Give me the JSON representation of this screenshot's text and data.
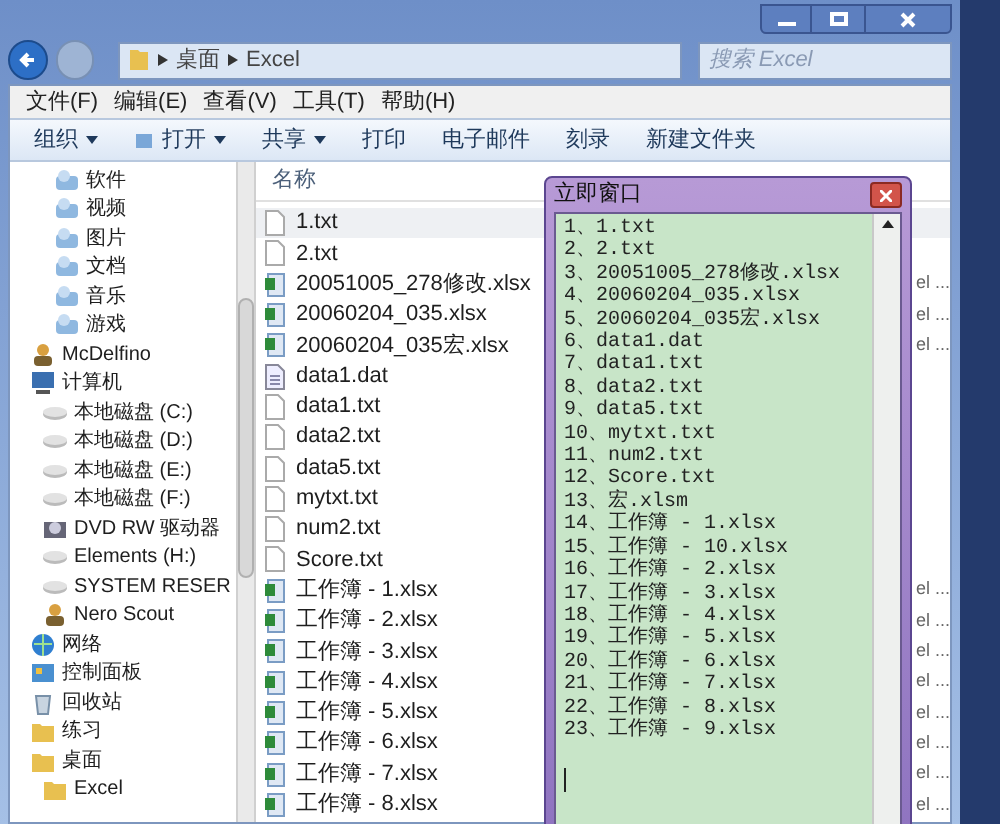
{
  "address_bar": {
    "path": [
      "桌面",
      "Excel"
    ],
    "search_placeholder": "搜索 Excel"
  },
  "menu_bar": [
    "文件(F)",
    "编辑(E)",
    "查看(V)",
    "工具(T)",
    "帮助(H)"
  ],
  "toolbar": [
    {
      "label": "组织",
      "dropdown": true
    },
    {
      "label": "打开",
      "dropdown": true,
      "icon": true
    },
    {
      "label": "共享",
      "dropdown": true
    },
    {
      "label": "打印",
      "dropdown": false
    },
    {
      "label": "电子邮件",
      "dropdown": false
    },
    {
      "label": "刻录",
      "dropdown": false
    },
    {
      "label": "新建文件夹",
      "dropdown": false
    }
  ],
  "sidebar": {
    "items": [
      {
        "children": [
          {
            "label": "软件",
            "kind": "library"
          },
          {
            "label": "视频",
            "kind": "library"
          },
          {
            "label": "图片",
            "kind": "library"
          },
          {
            "label": "文档",
            "kind": "library"
          },
          {
            "label": "音乐",
            "kind": "library"
          },
          {
            "label": "游戏",
            "kind": "library"
          }
        ]
      },
      {
        "label": "McDelfino",
        "kind": "user"
      },
      {
        "label": "计算机",
        "kind": "computer",
        "children": [
          {
            "label": "本地磁盘 (C:)",
            "kind": "drive"
          },
          {
            "label": "本地磁盘 (D:)",
            "kind": "drive"
          },
          {
            "label": "本地磁盘 (E:)",
            "kind": "drive"
          },
          {
            "label": "本地磁盘 (F:)",
            "kind": "drive"
          },
          {
            "label": "DVD RW 驱动器",
            "kind": "dvd"
          },
          {
            "label": "Elements (H:)",
            "kind": "drive"
          },
          {
            "label": "SYSTEM RESER",
            "kind": "drive"
          },
          {
            "label": "Nero Scout",
            "kind": "user"
          }
        ]
      },
      {
        "label": "网络",
        "kind": "network"
      },
      {
        "label": "控制面板",
        "kind": "control"
      },
      {
        "label": "回收站",
        "kind": "recycle"
      },
      {
        "label": "练习",
        "kind": "folder"
      },
      {
        "label": "桌面",
        "kind": "folder",
        "children": [
          {
            "label": "Excel",
            "kind": "folder"
          }
        ]
      }
    ]
  },
  "file_list": {
    "columns": [
      "名称"
    ],
    "rows": [
      {
        "name": "1.txt",
        "kind": "txt",
        "selected": true
      },
      {
        "name": "2.txt",
        "kind": "txt",
        "selected": false
      },
      {
        "name": "20051005_278修改.xlsx",
        "kind": "xlsx",
        "selected": false,
        "column_2": "el ..."
      },
      {
        "name": "20060204_035.xlsx",
        "kind": "xlsx",
        "selected": false,
        "column_2": "el ..."
      },
      {
        "name": "20060204_035宏.xlsx",
        "kind": "xlsx",
        "selected": false,
        "column_2": "el ..."
      },
      {
        "name": "data1.dat",
        "kind": "dat",
        "selected": false
      },
      {
        "name": "data1.txt",
        "kind": "txt",
        "selected": false
      },
      {
        "name": "data2.txt",
        "kind": "txt",
        "selected": false
      },
      {
        "name": "data5.txt",
        "kind": "txt",
        "selected": false
      },
      {
        "name": "mytxt.txt",
        "kind": "txt",
        "selected": false
      },
      {
        "name": "num2.txt",
        "kind": "txt",
        "selected": false
      },
      {
        "name": "Score.txt",
        "kind": "txt",
        "selected": false
      },
      {
        "name": "工作簿 - 1.xlsx",
        "kind": "xlsx",
        "selected": false,
        "column_2": "el ..."
      },
      {
        "name": "工作簿 - 2.xlsx",
        "kind": "xlsx",
        "selected": false,
        "column_2": "el ..."
      },
      {
        "name": "工作簿 - 3.xlsx",
        "kind": "xlsx",
        "selected": false,
        "column_2": "el ..."
      },
      {
        "name": "工作簿 - 4.xlsx",
        "kind": "xlsx",
        "selected": false,
        "column_2": "el ..."
      },
      {
        "name": "工作簿 - 5.xlsx",
        "kind": "xlsx",
        "selected": false,
        "column_2": "el ..."
      },
      {
        "name": "工作簿 - 6.xlsx",
        "kind": "xlsx",
        "selected": false,
        "column_2": "el ..."
      },
      {
        "name": "工作簿 - 7.xlsx",
        "kind": "xlsx",
        "selected": false,
        "column_2": "el ..."
      },
      {
        "name": "工作簿 - 8.xlsx",
        "kind": "xlsx",
        "selected": false,
        "column_2": "el ..."
      }
    ]
  },
  "immediate_window": {
    "title": "立即窗口",
    "lines": [
      "1、1.txt",
      "2、2.txt",
      "3、20051005_278修改.xlsx",
      "4、20060204_035.xlsx",
      "5、20060204_035宏.xlsx",
      "6、data1.dat",
      "7、data1.txt",
      "8、data2.txt",
      "9、data5.txt",
      "10、mytxt.txt",
      "11、num2.txt",
      "12、Score.txt",
      "13、宏.xlsm",
      "14、工作簿 - 1.xlsx",
      "15、工作簿 - 10.xlsx",
      "16、工作簿 - 2.xlsx",
      "17、工作簿 - 3.xlsx",
      "18、工作簿 - 4.xlsx",
      "19、工作簿 - 5.xlsx",
      "20、工作簿 - 6.xlsx",
      "21、工作簿 - 7.xlsx",
      "22、工作簿 - 8.xlsx",
      "23、工作簿 - 9.xlsx"
    ]
  }
}
